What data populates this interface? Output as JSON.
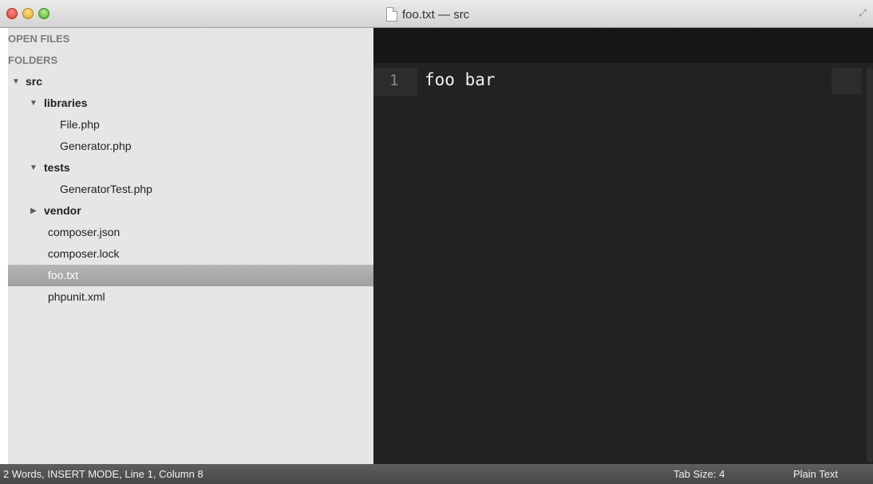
{
  "window": {
    "title": "foo.txt — src"
  },
  "sidebar": {
    "open_files_header": "OPEN FILES",
    "folders_header": "FOLDERS",
    "tree": [
      {
        "label": "src",
        "kind": "folder",
        "expanded": true
      },
      {
        "label": "libraries",
        "kind": "folder",
        "expanded": true
      },
      {
        "label": "File.php",
        "kind": "file"
      },
      {
        "label": "Generator.php",
        "kind": "file"
      },
      {
        "label": "tests",
        "kind": "folder",
        "expanded": true
      },
      {
        "label": "GeneratorTest.php",
        "kind": "file"
      },
      {
        "label": "vendor",
        "kind": "folder",
        "expanded": false
      },
      {
        "label": "composer.json",
        "kind": "file"
      },
      {
        "label": "composer.lock",
        "kind": "file"
      },
      {
        "label": "foo.txt",
        "kind": "file",
        "selected": true
      },
      {
        "label": "phpunit.xml",
        "kind": "file"
      }
    ]
  },
  "editor": {
    "line_number": "1",
    "line_text": "foo bar"
  },
  "statusbar": {
    "left": "2 Words, INSERT MODE, Line 1, Column 8",
    "tab_size": "Tab Size: 4",
    "syntax": "Plain Text"
  },
  "icons": {
    "expanded": "▼",
    "collapsed": "▶"
  },
  "colors": {
    "editor_bg": "#222222",
    "sidebar_bg": "#e6e6e6",
    "selected_row": "#a8a8a8",
    "statusbar_bg": "#515151"
  }
}
